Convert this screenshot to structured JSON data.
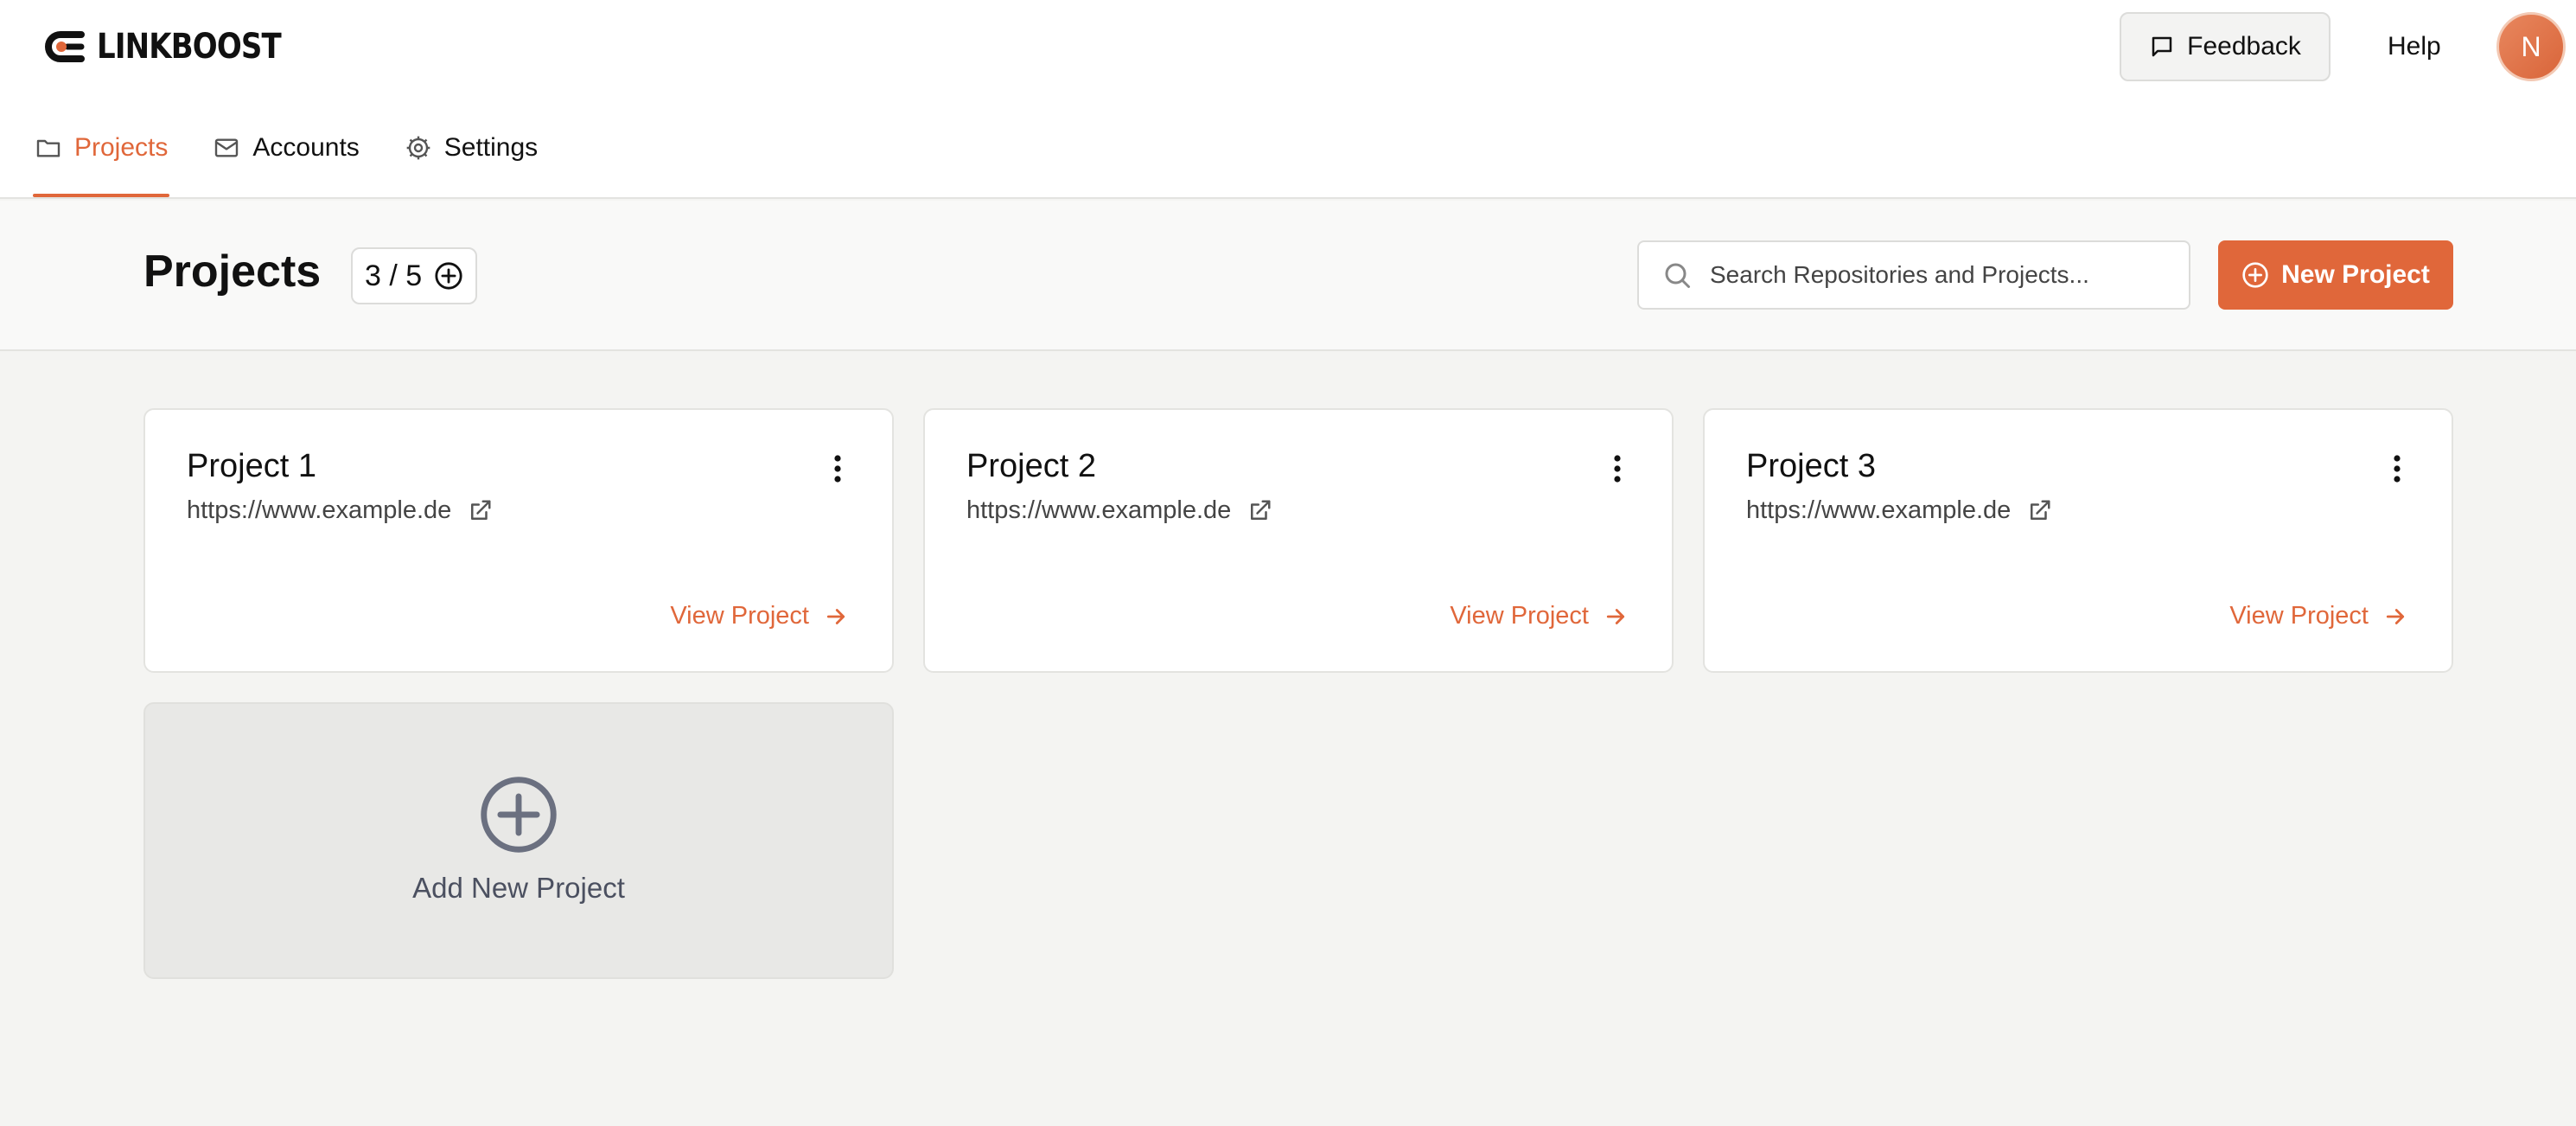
{
  "brand": {
    "name": "LINKBOOST",
    "accent": "#e0673a"
  },
  "header": {
    "feedback_label": "Feedback",
    "help_label": "Help",
    "avatar_initial": "N"
  },
  "nav": {
    "tabs": [
      {
        "label": "Projects",
        "icon": "folder-icon",
        "active": true
      },
      {
        "label": "Accounts",
        "icon": "mail-icon",
        "active": false
      },
      {
        "label": "Settings",
        "icon": "gear-icon",
        "active": false
      }
    ]
  },
  "subheader": {
    "title": "Projects",
    "count": "3 / 5",
    "search_placeholder": "Search Repositories and Projects...",
    "new_project_label": "New Project"
  },
  "projects": [
    {
      "name": "Project 1",
      "url": "https://www.example.de",
      "view_label": "View Project"
    },
    {
      "name": "Project 2",
      "url": "https://www.example.de",
      "view_label": "View Project"
    },
    {
      "name": "Project 3",
      "url": "https://www.example.de",
      "view_label": "View Project"
    }
  ],
  "add_card": {
    "label": "Add New Project"
  }
}
